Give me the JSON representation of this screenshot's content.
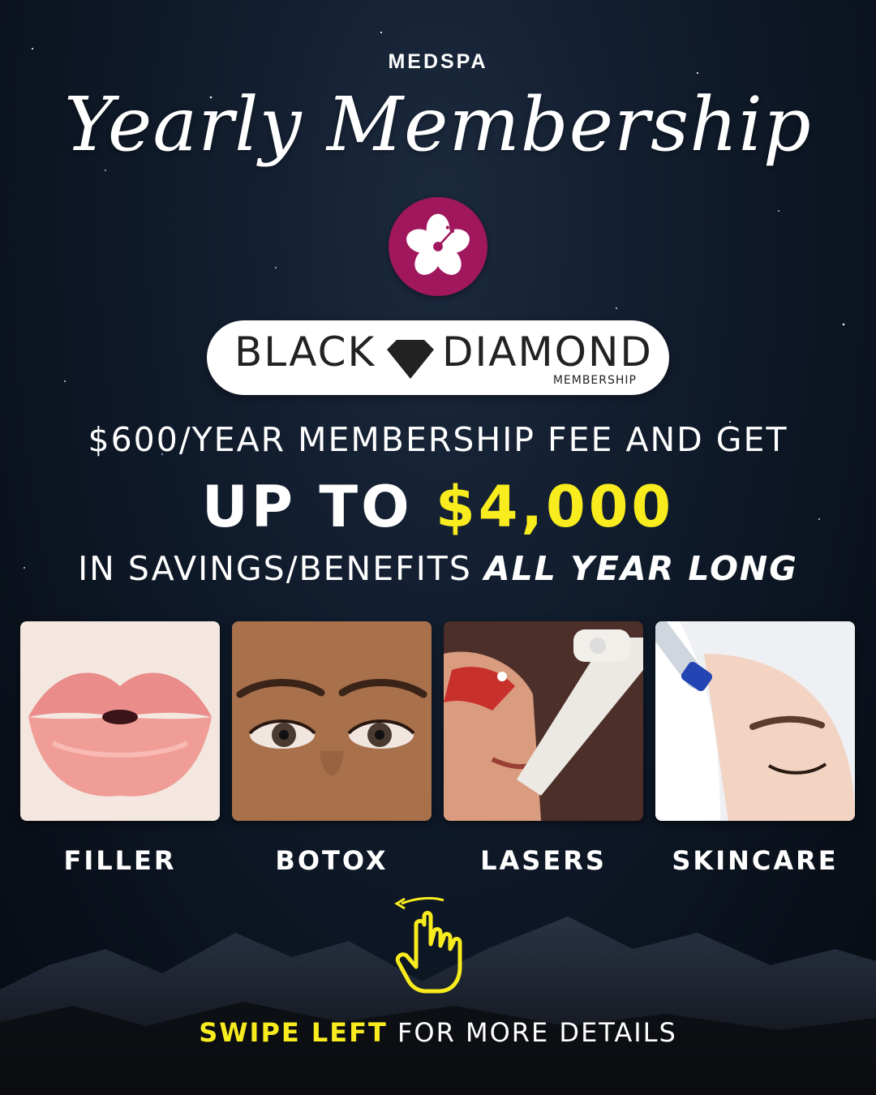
{
  "header": {
    "brand": "MEDSPA",
    "title": "Yearly Membership"
  },
  "logo": {
    "icon": "hibiscus-icon",
    "color": "#a0175d"
  },
  "badge": {
    "word_left": "BLACK",
    "icon": "diamond-icon",
    "word_right": "DIAMOND",
    "sub": "MEMBERSHIP"
  },
  "offer": {
    "line1": "$600/YEAR MEMBERSHIP FEE AND GET",
    "line2_prefix": "UP TO ",
    "line2_amount": "$4,000",
    "line3_prefix": "IN SAVINGS/BENEFITS ",
    "line3_emphasis": "ALL YEAR LONG"
  },
  "services": [
    {
      "label": "FILLER",
      "image": "lips-photo"
    },
    {
      "label": "BOTOX",
      "image": "eyes-photo"
    },
    {
      "label": "LASERS",
      "image": "laser-treatment-photo"
    },
    {
      "label": "SKINCARE",
      "image": "facial-treatment-photo"
    }
  ],
  "cta": {
    "icon": "swipe-hand-icon",
    "highlight": "SWIPE LEFT",
    "rest": " FOR MORE DETAILS"
  },
  "colors": {
    "accent_yellow": "#f8ec1e",
    "background": "#0f1a2a",
    "logo": "#a0175d"
  }
}
